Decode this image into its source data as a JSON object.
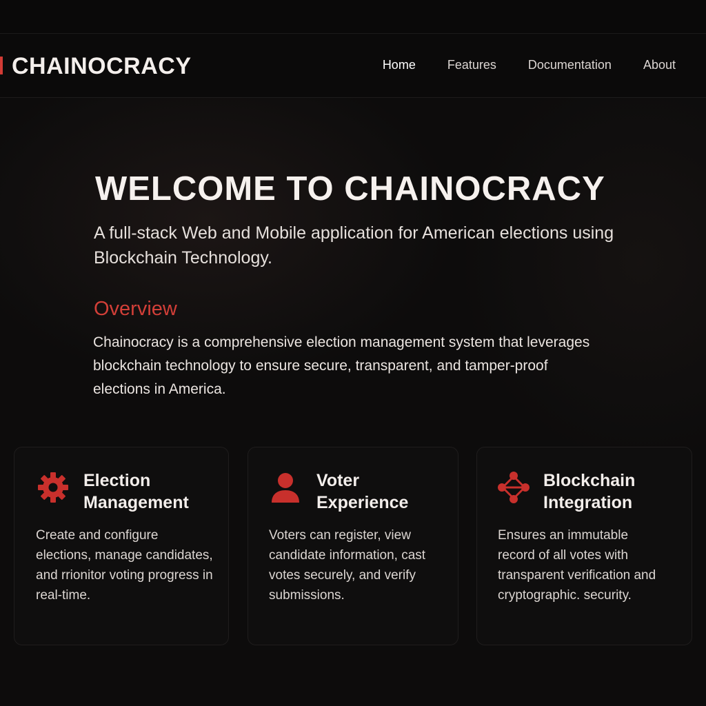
{
  "brand": {
    "name": "CHAINOCRACY",
    "accent_color": "#d23b35"
  },
  "nav": {
    "items": [
      {
        "label": "Home",
        "active": true
      },
      {
        "label": "Features",
        "active": false
      },
      {
        "label": "Documentation",
        "active": false
      },
      {
        "label": "About",
        "active": false
      }
    ]
  },
  "hero": {
    "title": "WELCOME TO CHAINOCRACY",
    "subtitle": "A full-stack Web and Mobile application for American elections using Blockchain Technology."
  },
  "overview": {
    "heading": "Overview",
    "text": "Chainocracy is a comprehensive election management system that leverages blockchain technology to ensure secure, transparent, and tamper-proof elections in America."
  },
  "features": [
    {
      "icon": "gear-icon",
      "title": "Election Management",
      "description": "Create and configure elections, manage candidates, and rrionitor voting progress in real-time."
    },
    {
      "icon": "user-icon",
      "title": "Voter Experience",
      "description": "Voters can register, view candidate information, cast votes securely, and verify submissions."
    },
    {
      "icon": "network-icon",
      "title": "Blockchain Integration",
      "description": "Ensures an immutable record of all votes with transparent verification and cryptographic. security."
    }
  ]
}
